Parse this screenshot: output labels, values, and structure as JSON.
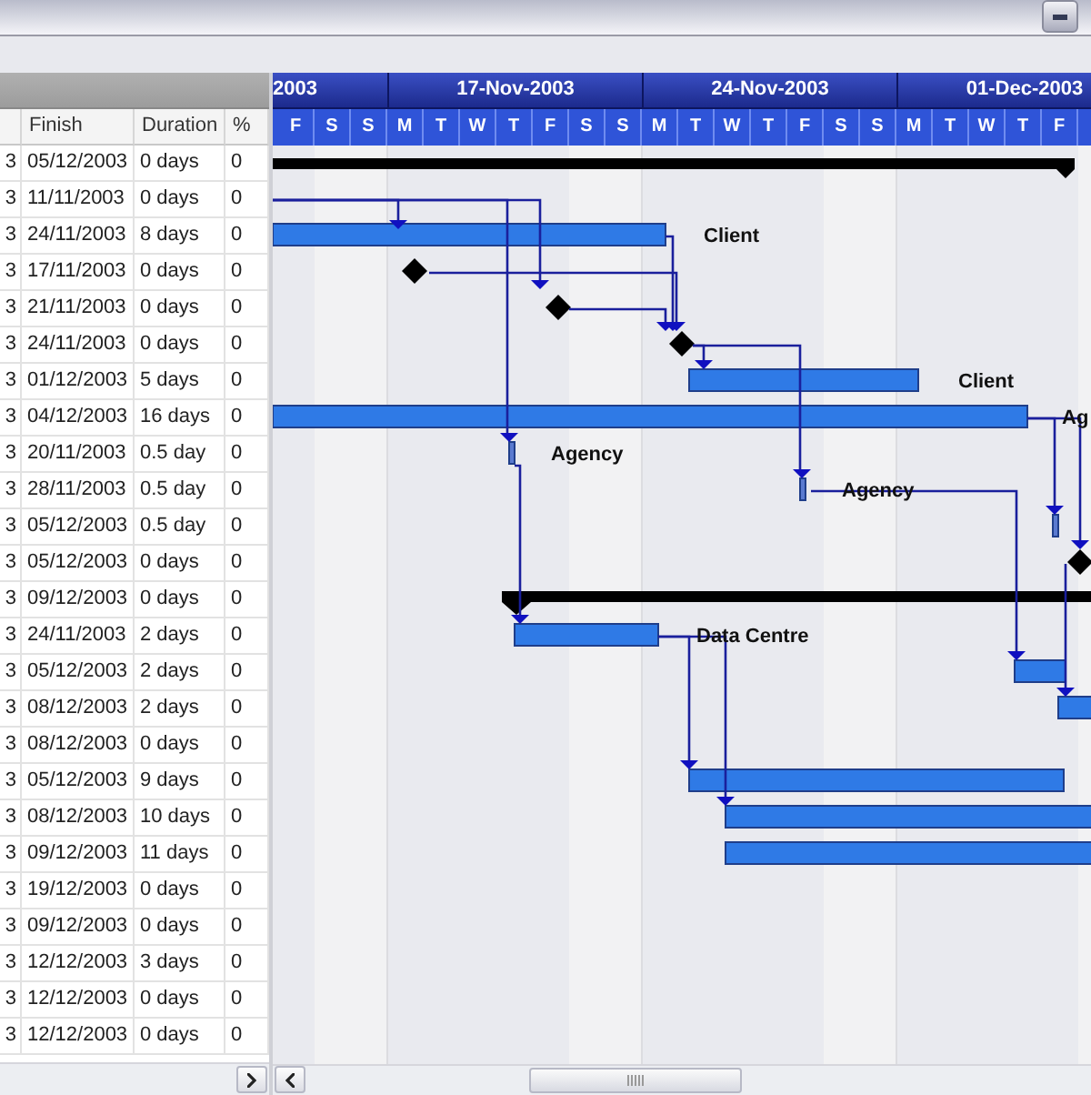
{
  "grid": {
    "columns": [
      "Finish",
      "Duration",
      "%"
    ],
    "rows": [
      {
        "start_tail": "3",
        "finish": "05/12/2003",
        "duration": "0 days",
        "percent": "0"
      },
      {
        "start_tail": "3",
        "finish": "11/11/2003",
        "duration": "0 days",
        "percent": "0"
      },
      {
        "start_tail": "3",
        "finish": "24/11/2003",
        "duration": "8 days",
        "percent": "0"
      },
      {
        "start_tail": "3",
        "finish": "17/11/2003",
        "duration": "0 days",
        "percent": "0"
      },
      {
        "start_tail": "3",
        "finish": "21/11/2003",
        "duration": "0 days",
        "percent": "0"
      },
      {
        "start_tail": "3",
        "finish": "24/11/2003",
        "duration": "0 days",
        "percent": "0"
      },
      {
        "start_tail": "3",
        "finish": "01/12/2003",
        "duration": "5 days",
        "percent": "0"
      },
      {
        "start_tail": "3",
        "finish": "04/12/2003",
        "duration": "16 days",
        "percent": "0"
      },
      {
        "start_tail": "3",
        "finish": "20/11/2003",
        "duration": "0.5 day",
        "percent": "0"
      },
      {
        "start_tail": "3",
        "finish": "28/11/2003",
        "duration": "0.5 day",
        "percent": "0"
      },
      {
        "start_tail": "3",
        "finish": "05/12/2003",
        "duration": "0.5 day",
        "percent": "0"
      },
      {
        "start_tail": "3",
        "finish": "05/12/2003",
        "duration": "0 days",
        "percent": "0"
      },
      {
        "start_tail": "3",
        "finish": "09/12/2003",
        "duration": "0 days",
        "percent": "0"
      },
      {
        "start_tail": "3",
        "finish": "24/11/2003",
        "duration": "2 days",
        "percent": "0"
      },
      {
        "start_tail": "3",
        "finish": "05/12/2003",
        "duration": "2 days",
        "percent": "0"
      },
      {
        "start_tail": "3",
        "finish": "08/12/2003",
        "duration": "2 days",
        "percent": "0"
      },
      {
        "start_tail": "3",
        "finish": "08/12/2003",
        "duration": "0 days",
        "percent": "0"
      },
      {
        "start_tail": "3",
        "finish": "05/12/2003",
        "duration": "9 days",
        "percent": "0"
      },
      {
        "start_tail": "3",
        "finish": "08/12/2003",
        "duration": "10 days",
        "percent": "0"
      },
      {
        "start_tail": "3",
        "finish": "09/12/2003",
        "duration": "11 days",
        "percent": "0"
      },
      {
        "start_tail": "3",
        "finish": "19/12/2003",
        "duration": "0 days",
        "percent": "0"
      },
      {
        "start_tail": "3",
        "finish": "09/12/2003",
        "duration": "0 days",
        "percent": "0"
      },
      {
        "start_tail": "3",
        "finish": "12/12/2003",
        "duration": "3 days",
        "percent": "0"
      },
      {
        "start_tail": "3",
        "finish": "12/12/2003",
        "duration": "0 days",
        "percent": "0"
      },
      {
        "start_tail": "3",
        "finish": "12/12/2003",
        "duration": "0 days",
        "percent": "0"
      }
    ]
  },
  "timeline": {
    "weeks": [
      "2003",
      "17-Nov-2003",
      "24-Nov-2003",
      "01-Dec-2003"
    ],
    "days": [
      "F",
      "S",
      "S",
      "M",
      "T",
      "W",
      "T",
      "F",
      "S",
      "S",
      "M",
      "T",
      "W",
      "T",
      "F",
      "S",
      "S",
      "M",
      "T",
      "W",
      "T",
      "F"
    ]
  },
  "gantt": {
    "bar_labels": [
      "Client",
      "Client",
      "Ag",
      "Agency",
      "Agency",
      "Data Centre"
    ]
  }
}
